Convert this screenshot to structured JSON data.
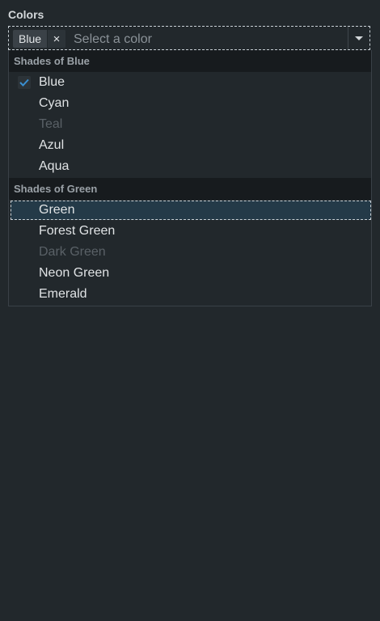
{
  "field": {
    "label": "Colors",
    "placeholder": "Select a color"
  },
  "selected": [
    {
      "label": "Blue",
      "remove_glyph": "×"
    }
  ],
  "groups": [
    {
      "header": "Shades of Blue",
      "options": [
        {
          "label": "Blue",
          "selected": true,
          "disabled": false
        },
        {
          "label": "Cyan",
          "selected": false,
          "disabled": false
        },
        {
          "label": "Teal",
          "selected": false,
          "disabled": true
        },
        {
          "label": "Azul",
          "selected": false,
          "disabled": false
        },
        {
          "label": "Aqua",
          "selected": false,
          "disabled": false
        }
      ]
    },
    {
      "header": "Shades of Green",
      "options": [
        {
          "label": "Green",
          "selected": false,
          "disabled": false,
          "focused": true
        },
        {
          "label": "Forest Green",
          "selected": false,
          "disabled": false
        },
        {
          "label": "Dark Green",
          "selected": false,
          "disabled": true
        },
        {
          "label": "Neon Green",
          "selected": false,
          "disabled": false
        },
        {
          "label": "Emerald",
          "selected": false,
          "disabled": false
        }
      ]
    }
  ],
  "icons": {
    "check": "check-icon",
    "remove": "close-icon",
    "toggle": "chevron-down-icon"
  },
  "colors": {
    "background": "#22282c",
    "accent": "#3a8fd1",
    "focus_fill": "#243a48",
    "group_header_bg": "#171b1e"
  }
}
